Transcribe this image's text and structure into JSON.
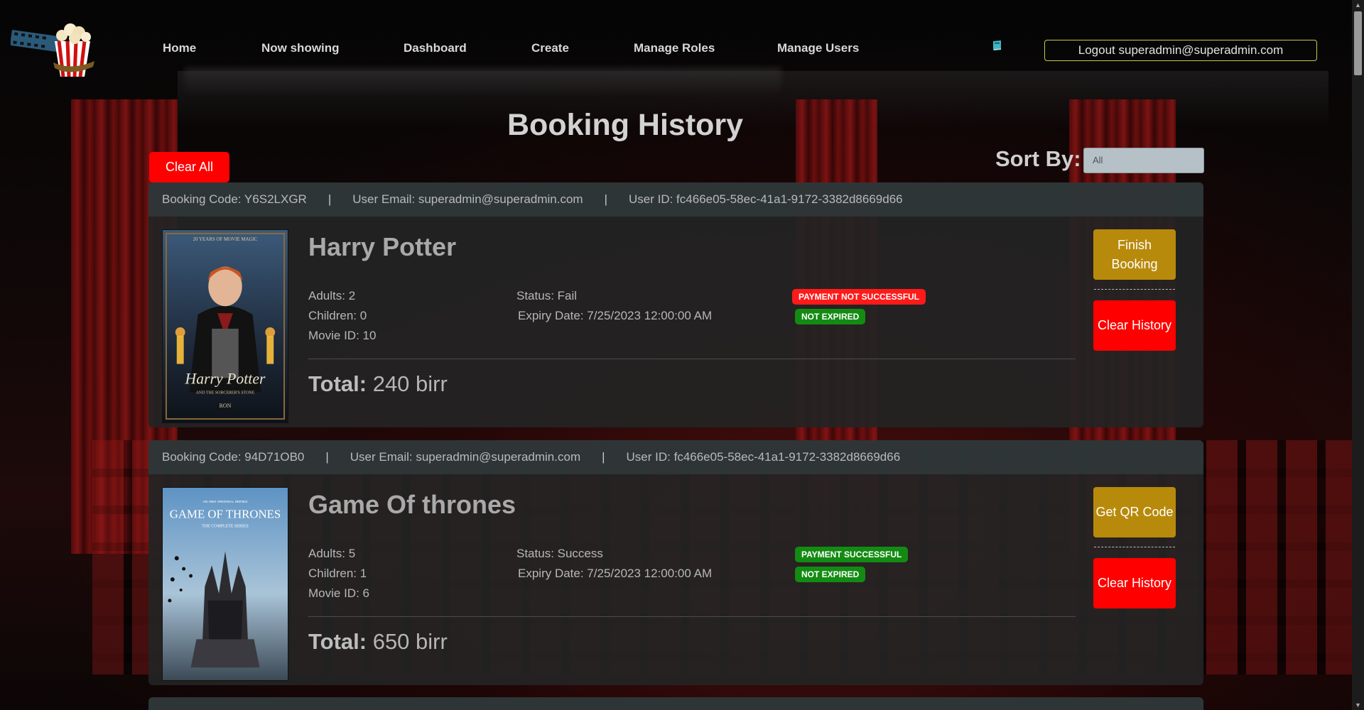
{
  "nav": {
    "links": [
      "Home",
      "Now showing",
      "Dashboard",
      "Create",
      "Manage Roles",
      "Manage Users"
    ],
    "logout": "Logout superadmin@superadmin.com",
    "logo_icon": "popcorn-film-logo",
    "book_icon": "book-icon"
  },
  "page": {
    "title": "Booking History",
    "clear_all": "Clear All",
    "sort_label": "Sort By:",
    "sort_value": "All"
  },
  "bookings": [
    {
      "code": "Booking Code: Y6S2LXGR",
      "email": "User Email: superadmin@superadmin.com",
      "user_id": "User ID: fc466e05-58ec-41a1-9172-3382d8669d66",
      "movie": "Harry Potter",
      "adults": "Adults: 2",
      "children": "Children: 0",
      "movie_id": "Movie ID: 10",
      "status": "Status: Fail",
      "expiry": "Expiry Date: 7/25/2023 12:00:00 AM",
      "payment_badge": "PAYMENT NOT SUCCESSFUL",
      "payment_color": "#ff1a1a",
      "expiry_badge": "NOT EXPIRED",
      "total_label": "Total:",
      "total_value": "240 birr",
      "primary_action": "Finish Booking",
      "secondary_action": "Clear History",
      "poster_text": [
        "20 YEARS OF MOVIE MAGIC",
        "Harry Potter",
        "AND THE SORCERER'S STONE",
        "RON"
      ]
    },
    {
      "code": "Booking Code: 94D71OB0",
      "email": "User Email: superadmin@superadmin.com",
      "user_id": "User ID: fc466e05-58ec-41a1-9172-3382d8669d66",
      "movie": "Game Of thrones",
      "adults": "Adults: 5",
      "children": "Children: 1",
      "movie_id": "Movie ID: 6",
      "status": "Status: Success",
      "expiry": "Expiry Date: 7/25/2023 12:00:00 AM",
      "payment_badge": "PAYMENT SUCCESSFUL",
      "payment_color": "#138b13",
      "expiry_badge": "NOT EXPIRED",
      "total_label": "Total:",
      "total_value": "650 birr",
      "primary_action": "Get QR Code",
      "secondary_action": "Clear History",
      "poster_text": [
        "AN HBO ORIGINAL SERIES",
        "GAME OF THRONES",
        "THE COMPLETE SERIES"
      ]
    }
  ]
}
